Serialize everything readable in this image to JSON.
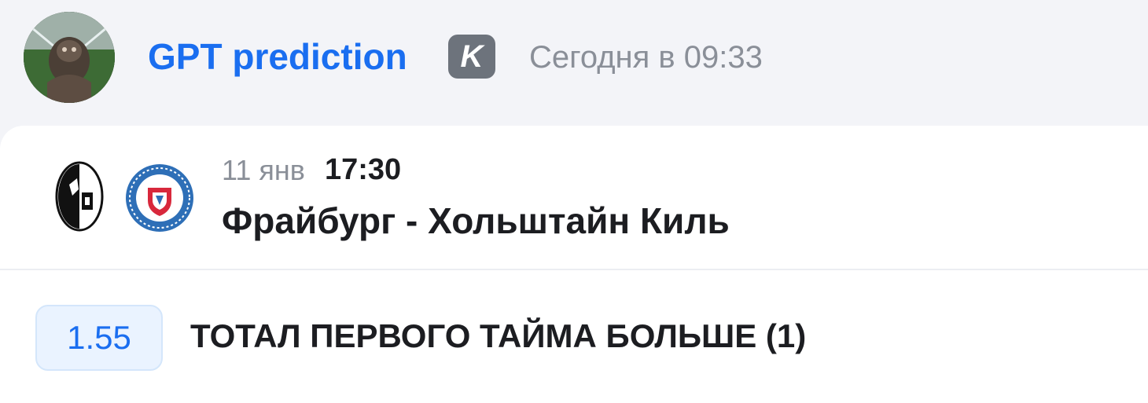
{
  "header": {
    "author": "GPT prediction",
    "badge": "K",
    "timestamp": "Сегодня в 09:33"
  },
  "match": {
    "date": "11 янв",
    "time": "17:30",
    "title": "Фрайбург - Хольштайн Киль",
    "home_logo_icon": "freiburg-crest-icon",
    "away_logo_icon": "holstein-kiel-crest-icon"
  },
  "bet": {
    "odds": "1.55",
    "description": "ТОТАЛ ПЕРВОГО ТАЙМА БОЛЬШЕ (1)"
  },
  "colors": {
    "accent": "#1a6ef0",
    "background": "#f3f4f8",
    "card": "#ffffff",
    "odds_bg": "#eaf3ff",
    "muted": "#8a8f98",
    "badge": "#6d737c"
  }
}
